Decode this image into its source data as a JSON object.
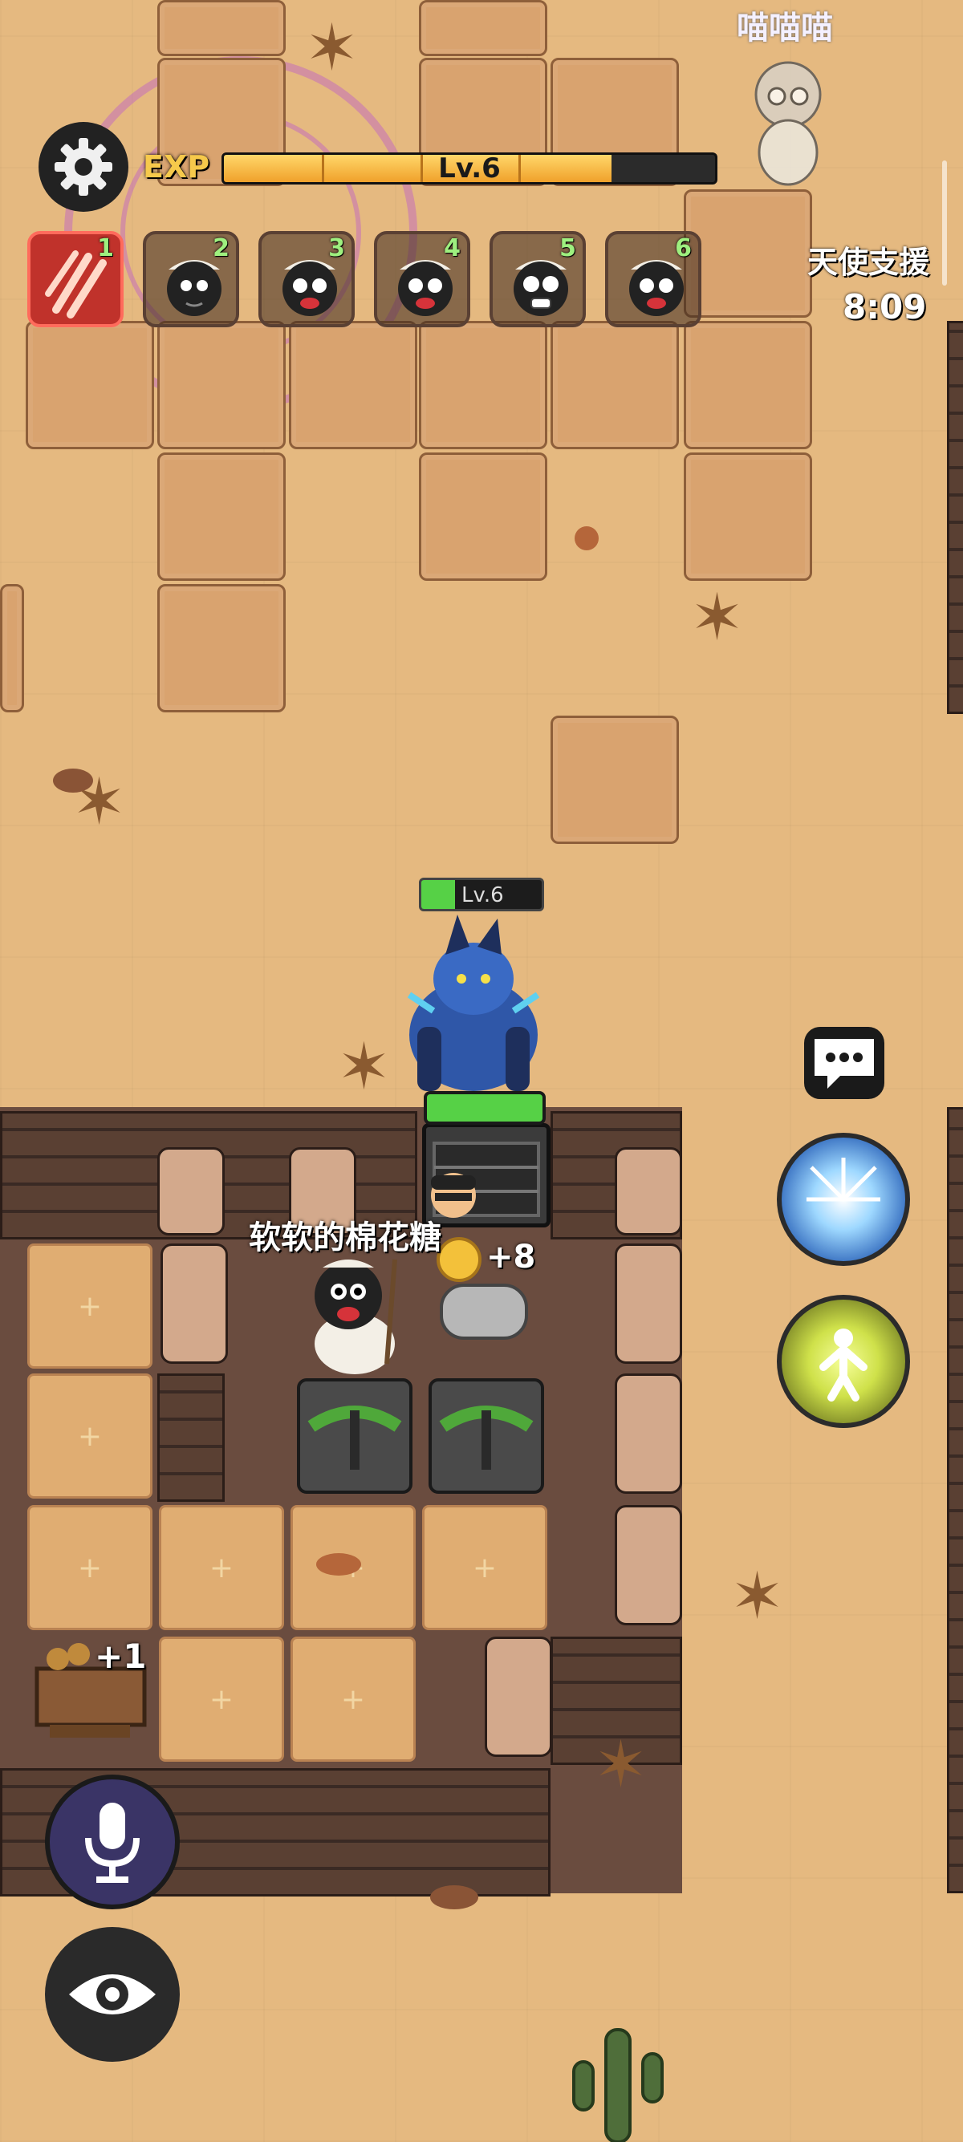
{
  "hud": {
    "exp_label": "EXP",
    "level_text": "Lv.6",
    "exp_progress": 0.79,
    "exp_color": "#f6c94b"
  },
  "skill_bar": {
    "slots": [
      {
        "num": "1",
        "icon": "claw-slash-icon",
        "active": true
      },
      {
        "num": "2",
        "icon": "sheep-face-icon"
      },
      {
        "num": "3",
        "icon": "sheep-face-icon"
      },
      {
        "num": "4",
        "icon": "sheep-face-icon"
      },
      {
        "num": "5",
        "icon": "sheep-face-icon"
      },
      {
        "num": "6",
        "icon": "sheep-face-icon"
      }
    ]
  },
  "ally": {
    "name": "喵喵喵"
  },
  "angel_support": {
    "title": "天使支援",
    "timer": "8:09"
  },
  "monster": {
    "level": "Lv.6",
    "hp_fraction": 0.28
  },
  "gate": {
    "hp_fraction": 1.0
  },
  "player": {
    "name": "软软的棉花糖",
    "gain": "+8"
  },
  "resource": {
    "gain": "+1"
  },
  "buttons": {
    "settings": "gear-icon",
    "chat": "chat-bubble-icon",
    "skill_lightning": "lightning-burst-icon",
    "skill_power": "power-aura-icon",
    "voice": "microphone-icon",
    "view": "eye-icon"
  },
  "colors": {
    "accent_green": "#56d146",
    "skill_active": "#c0322b",
    "sand": "#e5b980"
  }
}
